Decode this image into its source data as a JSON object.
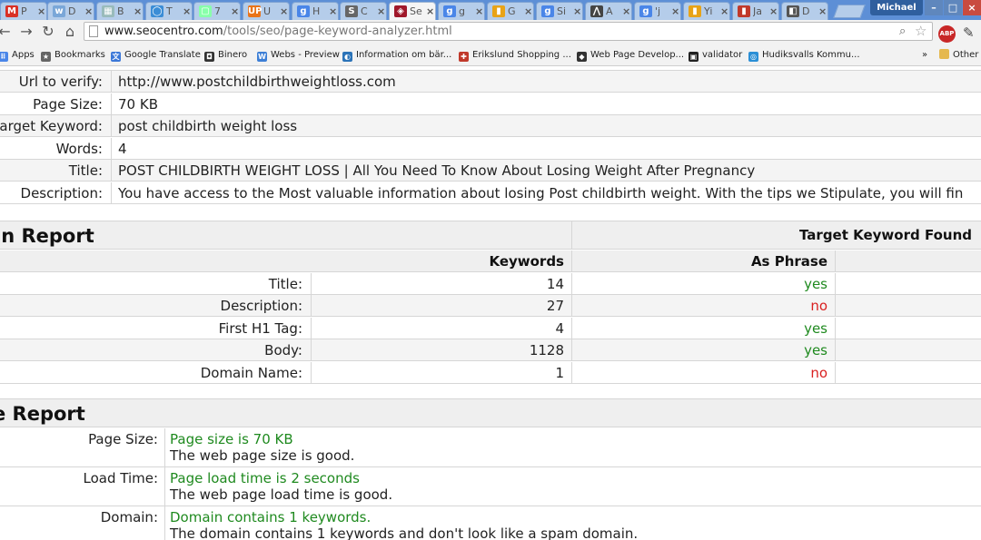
{
  "browser": {
    "tabs": [
      {
        "fav": "M",
        "favColor": "#d93025",
        "title": "P"
      },
      {
        "fav": "w",
        "favColor": "#7aa7d8",
        "title": "D"
      },
      {
        "fav": "▦",
        "favColor": "#9bb",
        "title": "B"
      },
      {
        "fav": "◯",
        "favColor": "#3b8dd6",
        "title": "T"
      },
      {
        "fav": "▢",
        "favColor": "#8fa",
        "title": "7"
      },
      {
        "fav": "UP",
        "favColor": "#e9741a",
        "title": "U"
      },
      {
        "fav": "g",
        "favColor": "#4a86e8",
        "title": "H"
      },
      {
        "fav": "S",
        "favColor": "#666666",
        "title": "C"
      },
      {
        "fav": "◈",
        "favColor": "#a0182a",
        "title": "Se"
      },
      {
        "fav": "g",
        "favColor": "#4a86e8",
        "title": "g"
      },
      {
        "fav": "▮",
        "favColor": "#e8a317",
        "title": "G"
      },
      {
        "fav": "g",
        "favColor": "#4a86e8",
        "title": "Si"
      },
      {
        "fav": "⋀",
        "favColor": "#444444",
        "title": "A"
      },
      {
        "fav": "g",
        "favColor": "#4a86e8",
        "title": "'j"
      },
      {
        "fav": "▮",
        "favColor": "#e8a317",
        "title": "Yi"
      },
      {
        "fav": "▮",
        "favColor": "#c0392b",
        "title": "Ja"
      },
      {
        "fav": "◧",
        "favColor": "#555555",
        "title": "D"
      }
    ],
    "profile": "Michael",
    "url_host": "www.seocentro.com",
    "url_path": "/tools/seo/page-keyword-analyzer.html",
    "bookmarks": [
      {
        "label": "Apps",
        "color": "#4a86e8",
        "glyph": "⠿"
      },
      {
        "label": "Bookmarks",
        "color": "#666666",
        "glyph": "★"
      },
      {
        "label": "Google Translate",
        "color": "#3c78d8",
        "glyph": "文"
      },
      {
        "label": "Binero",
        "color": "#333333",
        "glyph": "◘"
      },
      {
        "label": "Webs - Preview",
        "color": "#3d7fd6",
        "glyph": "W"
      },
      {
        "label": "Information om bär...",
        "color": "#2b73b8",
        "glyph": "◐"
      },
      {
        "label": "Erikslund Shopping ...",
        "color": "#c0392b",
        "glyph": "✚"
      },
      {
        "label": "Web Page Develop...",
        "color": "#333333",
        "glyph": "◆"
      },
      {
        "label": "validator",
        "color": "#222222",
        "glyph": "▣"
      },
      {
        "label": "Hudiksvalls Kommu...",
        "color": "#2b8fd6",
        "glyph": "◎"
      }
    ],
    "bookmarks_more": "»",
    "other_bookmarks": "Other"
  },
  "info": {
    "rows": [
      {
        "label": "Url to verify:",
        "value": "http://www.postchildbirthweightloss.com"
      },
      {
        "label": "Page Size:",
        "value": "70 KB"
      },
      {
        "label": "arget Keyword:",
        "value": "post childbirth weight loss"
      },
      {
        "label": "Words:",
        "value": "4"
      },
      {
        "label": "Title:",
        "value": "POST CHILDBIRTH WEIGHT LOSS | All You Need To Know About Losing Weight After Pregnancy"
      },
      {
        "label": "Description:",
        "value": "You have access to the Most valuable information about losing Post childbirth weight. With the tips we Stipulate, you will fin"
      }
    ]
  },
  "domain_report": {
    "title": "in Report",
    "found_header": "Target Keyword Found",
    "col_keywords": "Keywords",
    "col_phrase": "As Phrase",
    "rows": [
      {
        "label": "Title:",
        "keywords": "14",
        "phrase": "yes",
        "ok": true
      },
      {
        "label": "Description:",
        "keywords": "27",
        "phrase": "no",
        "ok": false
      },
      {
        "label": "First H1 Tag:",
        "keywords": "4",
        "phrase": "yes",
        "ok": true
      },
      {
        "label": "Body:",
        "keywords": "1128",
        "phrase": "yes",
        "ok": true
      },
      {
        "label": "Domain Name:",
        "keywords": "1",
        "phrase": "no",
        "ok": false
      }
    ]
  },
  "page_report": {
    "title": "e Report",
    "rows": [
      {
        "label": "Page Size:",
        "status": "Page size is 70 KB",
        "detail": "The web page size is good."
      },
      {
        "label": "Load Time:",
        "status": "Page load time is 2 seconds",
        "detail": "The web page load time is good."
      },
      {
        "label": "Domain:",
        "status": "Domain contains 1 keywords.",
        "detail": "The domain contains 1 keywords and don't look like a spam domain."
      }
    ]
  },
  "colors": {
    "ok": "#1f8a1f",
    "bad": "#d92020"
  }
}
